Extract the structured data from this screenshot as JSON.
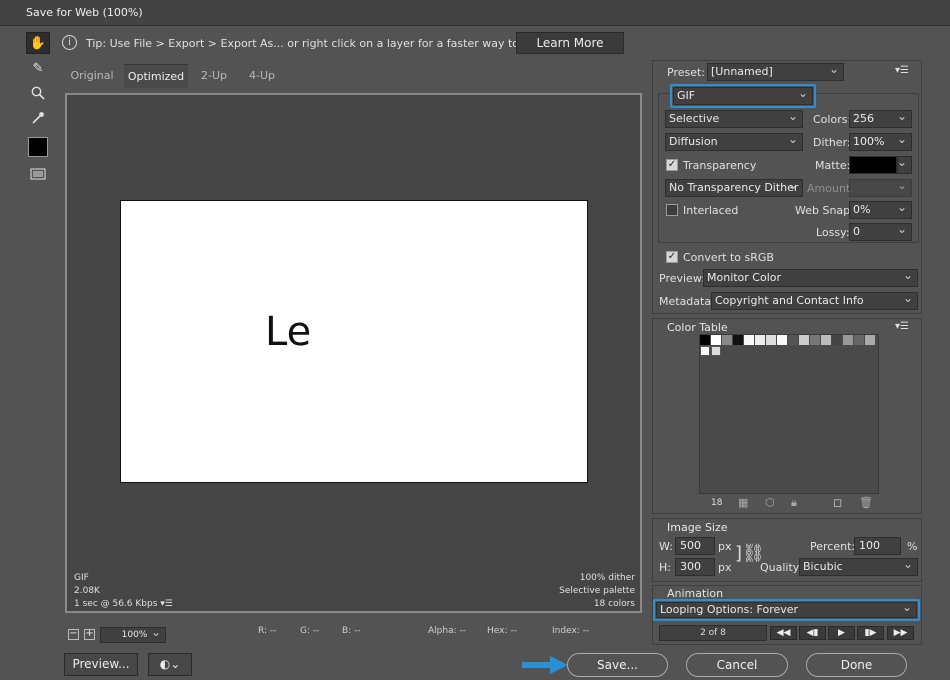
{
  "window": {
    "title": "Save for Web (100%)"
  },
  "tip": {
    "text": "Tip: Use File > Export > Export As...  or right click on a layer for a faster way to export assets",
    "learn_more": "Learn More"
  },
  "tabs": [
    "Original",
    "Optimized",
    "2-Up",
    "4-Up"
  ],
  "canvas": {
    "text": "Le",
    "info_left": [
      "GIF",
      "2.08K",
      "1 sec @ 56.6 Kbps"
    ],
    "info_right": [
      "100% dither",
      "Selective palette",
      "18 colors"
    ]
  },
  "status": {
    "zoom": "100%",
    "r": "R: --",
    "g": "G: --",
    "b": "B: --",
    "alpha": "Alpha: --",
    "hex": "Hex: --",
    "index": "Index: --"
  },
  "bottom": {
    "preview": "Preview...",
    "save": "Save...",
    "cancel": "Cancel",
    "done": "Done"
  },
  "preset": {
    "label": "Preset:",
    "value": "[Unnamed]",
    "format": "GIF",
    "reduction": "Selective",
    "colors_label": "Colors:",
    "colors": "256",
    "dither_algo": "Diffusion",
    "dither_label": "Dither:",
    "dither": "100%",
    "transparency": "Transparency",
    "matte_label": "Matte:",
    "trans_dither": "No Transparency Dither",
    "amount_label": "Amount:",
    "interlaced": "Interlaced",
    "websnap_label": "Web Snap:",
    "websnap": "0%",
    "lossy_label": "Lossy:",
    "lossy": "0"
  },
  "convert": "Convert to sRGB",
  "preview_row": {
    "label": "Preview:",
    "value": "Monitor Color"
  },
  "metadata_row": {
    "label": "Metadata:",
    "value": "Copyright and Contact Info"
  },
  "color_table": {
    "title": "Color Table",
    "count": "18"
  },
  "image_size": {
    "title": "Image Size",
    "w_label": "W:",
    "w": "500",
    "h_label": "H:",
    "h": "300",
    "unit": "px",
    "percent_label": "Percent:",
    "percent": "100",
    "pct": "%",
    "quality_label": "Quality:",
    "quality": "Bicubic"
  },
  "animation": {
    "title": "Animation",
    "loop_label": "Looping Options:",
    "loop_value": "Forever",
    "frame": "2 of 8"
  },
  "colors": {
    "accent": "#2b8fd6",
    "bg": "#535353"
  }
}
